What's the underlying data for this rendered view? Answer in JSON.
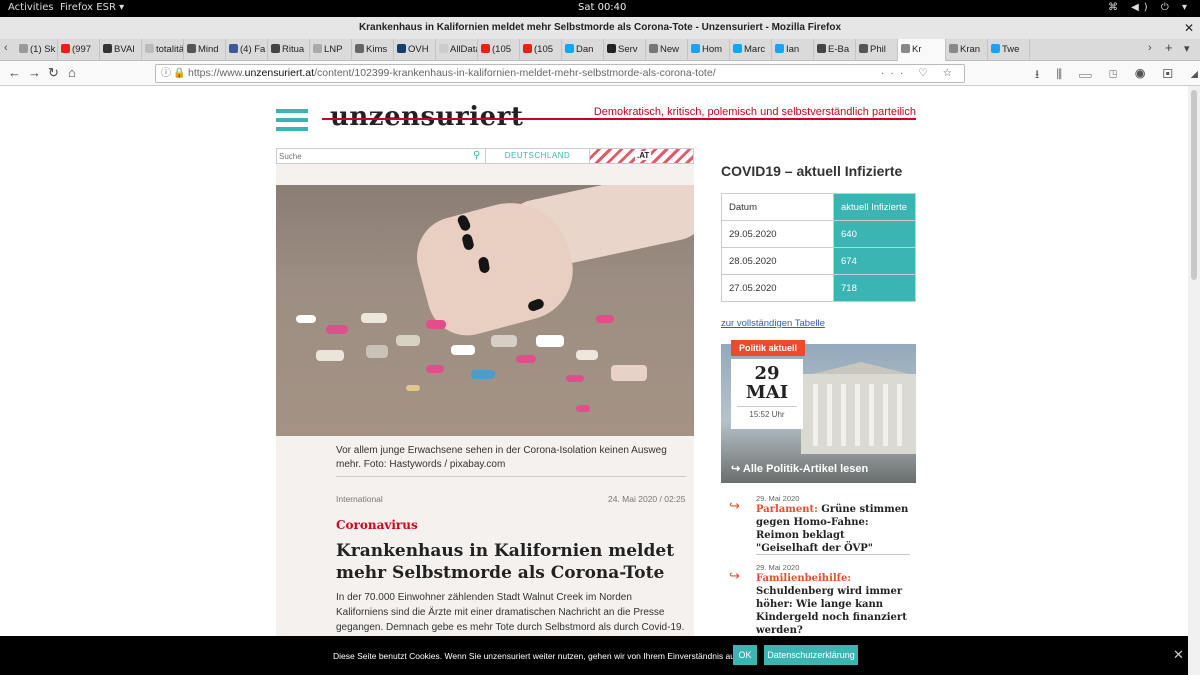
{
  "topbar": {
    "activities": "Activities",
    "app": "Firefox ESR ▾",
    "clock": "Sat 00:40"
  },
  "window": {
    "title": "Krankenhaus in Kalifornien meldet mehr Selbstmorde als Corona-Tote - Unzensuriert - Mozilla Firefox"
  },
  "tabs": [
    {
      "label": "(1) Sk",
      "color": "#999"
    },
    {
      "label": "(997",
      "color": "#e62117"
    },
    {
      "label": "BVAI",
      "color": "#333"
    },
    {
      "label": "totalitär",
      "color": "#bbb"
    },
    {
      "label": "Mind",
      "color": "#555"
    },
    {
      "label": "(4) Fa",
      "color": "#3b5998"
    },
    {
      "label": "Ritua",
      "color": "#444"
    },
    {
      "label": "LNP",
      "color": "#aaa"
    },
    {
      "label": "Kims",
      "color": "#666"
    },
    {
      "label": "OVH",
      "color": "#123f6d"
    },
    {
      "label": "AllData",
      "color": "#ccc"
    },
    {
      "label": "(105",
      "color": "#e62117"
    },
    {
      "label": "(105",
      "color": "#e62117"
    },
    {
      "label": "Dan",
      "color": "#1da1f2"
    },
    {
      "label": "Serv",
      "color": "#222"
    },
    {
      "label": "New",
      "color": "#777"
    },
    {
      "label": "Hom",
      "color": "#1da1f2"
    },
    {
      "label": "Marc",
      "color": "#1da1f2"
    },
    {
      "label": "Ian",
      "color": "#1da1f2"
    },
    {
      "label": "E-Ba",
      "color": "#444"
    },
    {
      "label": "Phil",
      "color": "#555"
    },
    {
      "label": "Kr",
      "color": "#888",
      "active": true
    },
    {
      "label": "Kran",
      "color": "#888"
    },
    {
      "label": "Twe",
      "color": "#1da1f2"
    }
  ],
  "url": {
    "prefix": "https://www.",
    "domain": "unzensuriert.at",
    "path": "/content/102399-krankenhaus-in-kalifornien-meldet-mehr-selbstmorde-als-corona-tote/"
  },
  "site": {
    "logo": "unzensuriert",
    "tagline": "Demokratisch, kritisch, polemisch und selbstverständlich parteilich",
    "search_placeholder": "Suche",
    "nav_de": "DEUTSCHLAND",
    "nav_at": ".AT"
  },
  "article": {
    "caption": "Vor allem junge Erwachsene sehen in der Corona-Isolation keinen Ausweg mehr. Foto: Hastywords / pixabay.com",
    "category": "International",
    "date": "24. Mai 2020 / 02:25",
    "kicker": "Coronavirus",
    "headline": "Krankenhaus in Kalifornien meldet mehr Selbstmorde als Corona-Tote",
    "body": "In der 70.000 Einwohner zählenden Stadt Walnut Creek im Norden Kaliforniens sind die Ärzte mit einer dramatischen Nachricht an die Presse gegangen. Demnach gebe es mehr Tote durch Selbstmord als durch Covid-19. Daher forderten die Ärzte in einer Nachricht, die Maßnahmen zu beenden."
  },
  "covid": {
    "title": "COVID19 – aktuell Infizierte",
    "headers": [
      "Datum",
      "aktuell Infizierte"
    ],
    "rows": [
      [
        "29.05.2020",
        "640"
      ],
      [
        "28.05.2020",
        "674"
      ],
      [
        "27.05.2020",
        "718"
      ]
    ],
    "link": "zur vollständigen Tabelle"
  },
  "politik": {
    "badge": "Politik aktuell",
    "day": "29",
    "month": "MAI",
    "time": "15:52 Uhr",
    "all_link": "Alle Politik-Artikel lesen"
  },
  "news": [
    {
      "date": "29. Mai 2020",
      "kw": "Parlament:",
      "title": " Grüne stimmen gegen Homo-Fahne: Reimon beklagt \"Geiselhaft der ÖVP\""
    },
    {
      "date": "29. Mai 2020",
      "kw": "Familienbeihilfe:",
      "title": " Schuldenberg wird immer höher: Wie lange kann Kindergeld noch finanziert werden?"
    }
  ],
  "cookie": {
    "message": "Diese Seite benutzt Cookies. Wenn Sie unzensuriert weiter nutzen, gehen wir von Ihrem Einverständnis aus.",
    "ok": "OK",
    "privacy": "Datenschutzerklärung"
  }
}
